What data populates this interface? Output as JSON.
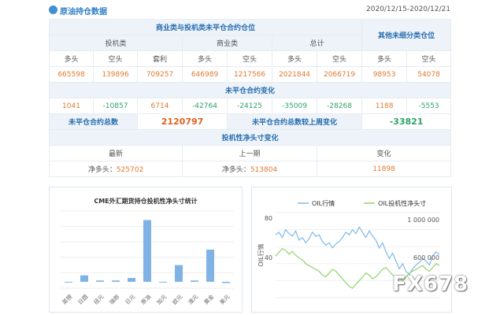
{
  "header": {
    "title": "原油持仓数据",
    "date_range": "2020/12/15-2020/12/21"
  },
  "table": {
    "section_title": "商业类与投机类未平仓合约仓位",
    "other_title": "其他未细分类仓位",
    "groups": {
      "spec": "投机类",
      "comm": "商业类",
      "total": "总计"
    },
    "col_labels": {
      "long": "多头",
      "short": "空头",
      "spread": "套利"
    },
    "values": [
      "665598",
      "139896",
      "709257",
      "646989",
      "1217566",
      "2021844",
      "2066719",
      "98953",
      "54078"
    ],
    "change_title": "未平仓合约变化",
    "changes": [
      "1041",
      "-10857",
      "6714",
      "-42764",
      "-24125",
      "-35009",
      "-28268",
      "1188",
      "-5553"
    ],
    "oi_total_label": "未平仓合约总数",
    "oi_total": "2120797",
    "oi_change_label": "未平仓合约总数较上周变化",
    "oi_change": "-33821",
    "net_title": "投机性净头寸变化",
    "net_cols": {
      "latest": "最新",
      "prev": "上一期",
      "change": "变化"
    },
    "net_label": "净多头：",
    "net_latest": "525702",
    "net_prev": "513804",
    "net_change": "11898"
  },
  "colors": {
    "accent": "#2f7fc9",
    "bar": "#7fb2e5",
    "oil_line": "#7fb9e8",
    "net_line": "#8fd36a",
    "red": "#e0621e",
    "green": "#2ea36a"
  },
  "chart_data": [
    {
      "type": "bar",
      "title": "CME外汇期货持仓投机性净头寸统计",
      "categories": [
        "英镑",
        "日圆",
        "纽元",
        "瑞郎",
        "日元",
        "原油",
        "加元",
        "欧元",
        "澳元",
        "黄金",
        "美元"
      ],
      "values": [
        0,
        5,
        1,
        1,
        3,
        48,
        0,
        13,
        1,
        25,
        -1
      ],
      "ylim": [
        -5,
        55
      ]
    },
    {
      "type": "line",
      "legend": [
        "OIL行情",
        "OIL投机性净头寸"
      ],
      "ylabel": "OIL行情",
      "left_ticks": [
        "80",
        "40"
      ],
      "right_ticks": [
        "1 000 000",
        "600 000"
      ],
      "series": [
        {
          "name": "OIL行情",
          "axis": "left",
          "ylim": [
            20,
            85
          ],
          "values": [
            68,
            70,
            66,
            72,
            69,
            67,
            71,
            64,
            66,
            62,
            65,
            70,
            67,
            68,
            63,
            60,
            62,
            58,
            61,
            63,
            66,
            70,
            68,
            72,
            69,
            74,
            70,
            66,
            71,
            67,
            64,
            58,
            62,
            55,
            50,
            54,
            48,
            42,
            46,
            40,
            38,
            42,
            45,
            47,
            50,
            48,
            45,
            52,
            55,
            53
          ]
        },
        {
          "name": "OIL投机性净头寸",
          "axis": "right",
          "ylim": [
            200000,
            1100000
          ],
          "values": [
            640000,
            680000,
            720000,
            700000,
            660000,
            690000,
            650000,
            620000,
            600000,
            560000,
            540000,
            520000,
            500000,
            480000,
            440000,
            420000,
            460000,
            500000,
            480000,
            440000,
            400000,
            360000,
            320000,
            300000,
            340000,
            380000,
            420000,
            460000,
            440000,
            400000,
            420000,
            460000,
            500000,
            520000,
            480000,
            440000,
            420000,
            400000,
            380000,
            420000,
            460000,
            480000,
            500000,
            520000,
            540000,
            500000,
            480000,
            520000,
            560000,
            540000
          ]
        }
      ]
    }
  ]
}
